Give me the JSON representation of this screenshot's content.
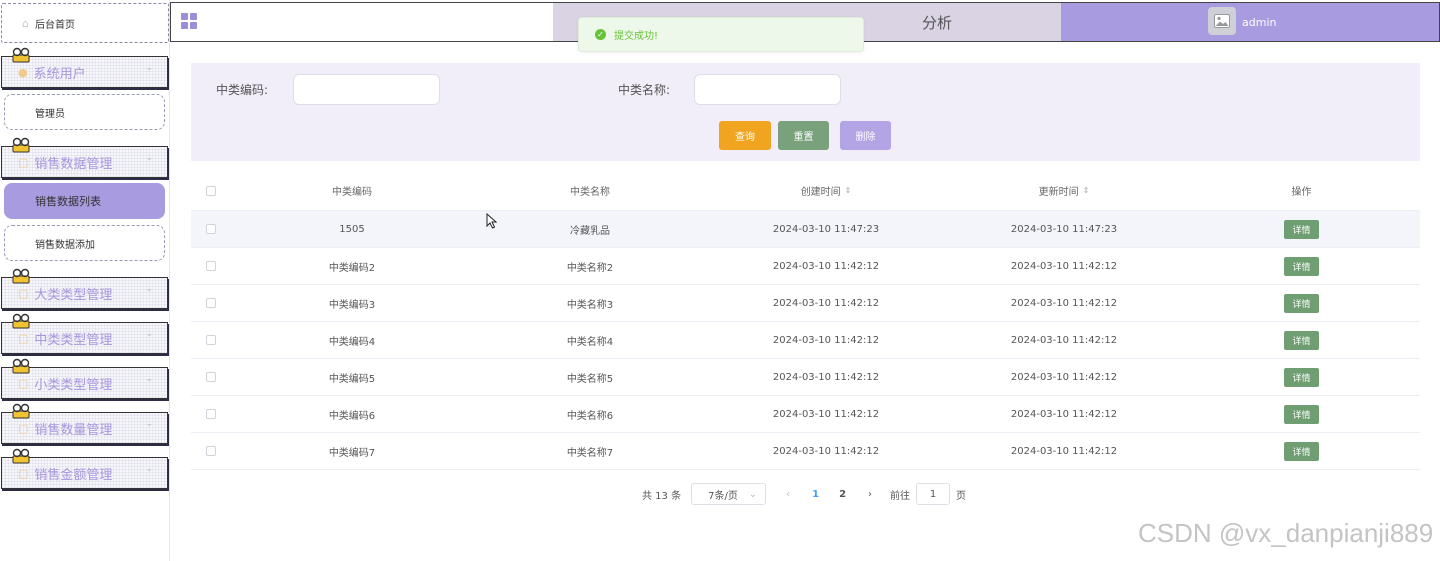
{
  "sidebar": {
    "home": "后台首页",
    "groups": [
      {
        "label": "系统用户",
        "items": [
          "管理员"
        ]
      },
      {
        "label": "销售数据管理",
        "items": [
          "销售数据列表",
          "销售数据添加"
        ]
      },
      {
        "label": "大类类型管理",
        "items": []
      },
      {
        "label": "中类类型管理",
        "items": []
      },
      {
        "label": "小类类型管理",
        "items": []
      },
      {
        "label": "销售数量管理",
        "items": []
      },
      {
        "label": "销售金额管理",
        "items": []
      }
    ]
  },
  "header": {
    "title": "分析",
    "user": "admin"
  },
  "toast": "提交成功!",
  "search": {
    "code_label": "中类编码:",
    "name_label": "中类名称:",
    "code_value": "",
    "name_value": "",
    "query": "查询",
    "reset": "重置",
    "delete": "删除"
  },
  "table": {
    "headers": [
      "中类编码",
      "中类名称",
      "创建时间",
      "更新时间",
      "操作"
    ],
    "rows": [
      [
        "1505",
        "冷藏乳品",
        "2024-03-10 11:47:23",
        "2024-03-10 11:47:23",
        "详情"
      ],
      [
        "中类编码2",
        "中类名称2",
        "2024-03-10 11:42:12",
        "2024-03-10 11:42:12",
        "详情"
      ],
      [
        "中类编码3",
        "中类名称3",
        "2024-03-10 11:42:12",
        "2024-03-10 11:42:12",
        "详情"
      ],
      [
        "中类编码4",
        "中类名称4",
        "2024-03-10 11:42:12",
        "2024-03-10 11:42:12",
        "详情"
      ],
      [
        "中类编码5",
        "中类名称5",
        "2024-03-10 11:42:12",
        "2024-03-10 11:42:12",
        "详情"
      ],
      [
        "中类编码6",
        "中类名称6",
        "2024-03-10 11:42:12",
        "2024-03-10 11:42:12",
        "详情"
      ],
      [
        "中类编码7",
        "中类名称7",
        "2024-03-10 11:42:12",
        "2024-03-10 11:42:12",
        "详情"
      ]
    ]
  },
  "pagination": {
    "total": "共 13 条",
    "page_size": "7条/页",
    "pages": [
      "1",
      "2"
    ],
    "goto_label": "前往",
    "goto_value": "1",
    "goto_suffix": "页"
  },
  "watermark": "CSDN @vx_danpianji889",
  "colors": {
    "accent": "#a99be0",
    "query_button": "#f0a420",
    "reset_button": "#78a17c",
    "delete_button": "#b3a4e6",
    "detail_button": "#6e9e72"
  },
  "icons": [
    "home-icon",
    "grid-menu-icon",
    "avatar-image-icon",
    "success-check-icon",
    "user-icon",
    "folder-icon",
    "chevron-down-icon",
    "sort-icon",
    "chevron-left-icon",
    "chevron-right-icon",
    "binder-clip-icon"
  ]
}
